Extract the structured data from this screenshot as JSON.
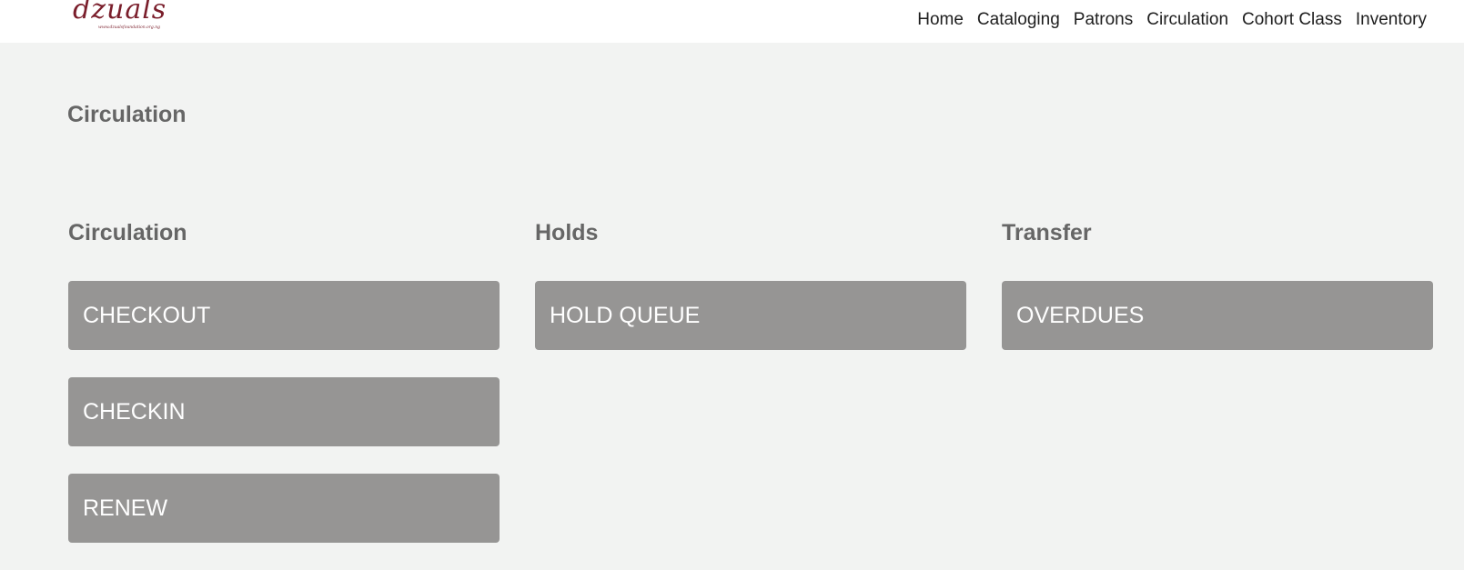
{
  "header": {
    "logo": {
      "script": "dzuals",
      "url": "www.dzualsfoundation.org.ng"
    },
    "nav": [
      {
        "label": "Home"
      },
      {
        "label": "Cataloging"
      },
      {
        "label": "Patrons"
      },
      {
        "label": "Circulation"
      },
      {
        "label": "Cohort Class"
      },
      {
        "label": "Inventory"
      }
    ]
  },
  "main": {
    "page_title": "Circulation",
    "columns": [
      {
        "heading": "Circulation",
        "buttons": [
          {
            "label": "CHECKOUT"
          },
          {
            "label": "CHECKIN"
          },
          {
            "label": "RENEW"
          }
        ]
      },
      {
        "heading": "Holds",
        "buttons": [
          {
            "label": "HOLD QUEUE"
          }
        ]
      },
      {
        "heading": "Transfer",
        "buttons": [
          {
            "label": "OVERDUES"
          }
        ]
      }
    ]
  },
  "colors": {
    "background": "#f2f3f2",
    "button": "#969594",
    "heading": "#666666",
    "logo": "#7a1e2b"
  }
}
